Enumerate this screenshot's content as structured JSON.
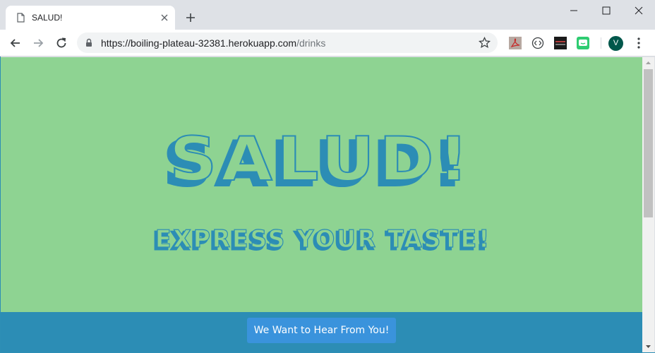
{
  "browser": {
    "tab": {
      "title": "SALUD!"
    },
    "address": {
      "host": "https://boiling-plateau-32381.herokuapp.com",
      "path": "/drinks"
    },
    "profile_initial": "V",
    "extensions": [
      "pdf-icon",
      "circle-code-icon",
      "dark-extension-icon",
      "green-chat-icon"
    ]
  },
  "page": {
    "title": "SALUD!",
    "subtitle": "EXPRESS YOUR TASTE!",
    "cta_label": "We Want to Hear From You!",
    "colors": {
      "background": "#8ed392",
      "text_face": "#8ed392",
      "text_shadow": "#2c8db5",
      "footer": "#2c8db5",
      "button": "#3a93dc"
    }
  }
}
